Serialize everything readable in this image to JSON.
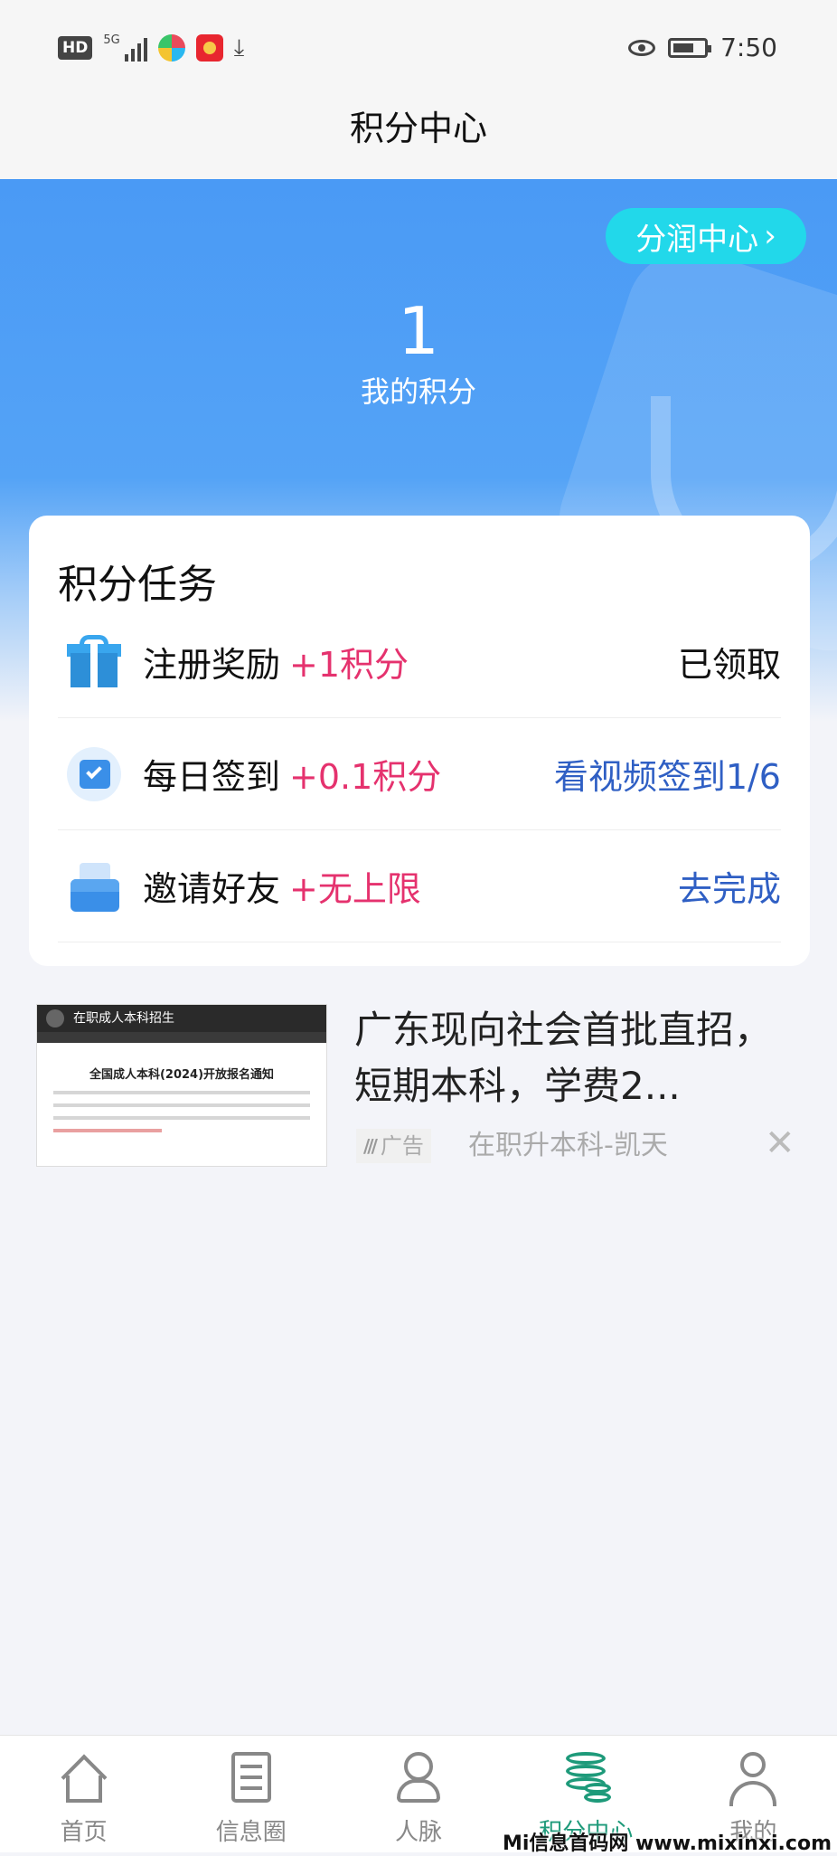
{
  "status_bar": {
    "hd": "HD",
    "signal": "5G",
    "time": "7:50"
  },
  "header": {
    "title": "积分中心"
  },
  "hero": {
    "share_center_label": "分润中心",
    "share_center_chevron": "›",
    "points_value": "1",
    "points_label": "我的积分"
  },
  "tasks": {
    "title": "积分任务",
    "items": [
      {
        "icon": "gift-icon",
        "name": "注册奖励",
        "reward": "+1积分",
        "action": "已领取",
        "action_style": "done"
      },
      {
        "icon": "calendar-check-icon",
        "name": "每日签到",
        "reward": "+0.1积分",
        "action": "看视频签到1/6",
        "action_style": "link"
      },
      {
        "icon": "invite-envelope-icon",
        "name": "邀请好友",
        "reward": "+无上限",
        "action": "去完成",
        "action_style": "link"
      }
    ]
  },
  "ad": {
    "thumb_header": "在职成人本科招生",
    "thumb_headline": "全国成人本科(2024)开放报名通知",
    "title": "广东现向社会首批直招，短期本科，学费2...",
    "badge": "广告",
    "source": "在职升本科-凯天",
    "close": "✕"
  },
  "tabs": [
    {
      "label": "首页",
      "icon": "home-icon",
      "active": false
    },
    {
      "label": "信息圈",
      "icon": "list-icon",
      "active": false
    },
    {
      "label": "人脉",
      "icon": "people-icon",
      "active": false
    },
    {
      "label": "积分中心",
      "icon": "coins-icon",
      "active": true
    },
    {
      "label": "我的",
      "icon": "user-icon",
      "active": false
    }
  ],
  "watermark": "Mi信息首码网 www.mixinxi.com",
  "colors": {
    "hero_blue": "#4a9af5",
    "share_button": "#22d8ea",
    "reward_pink": "#e5326e",
    "action_blue": "#2f5fc4",
    "tab_active": "#1e9a7a"
  }
}
